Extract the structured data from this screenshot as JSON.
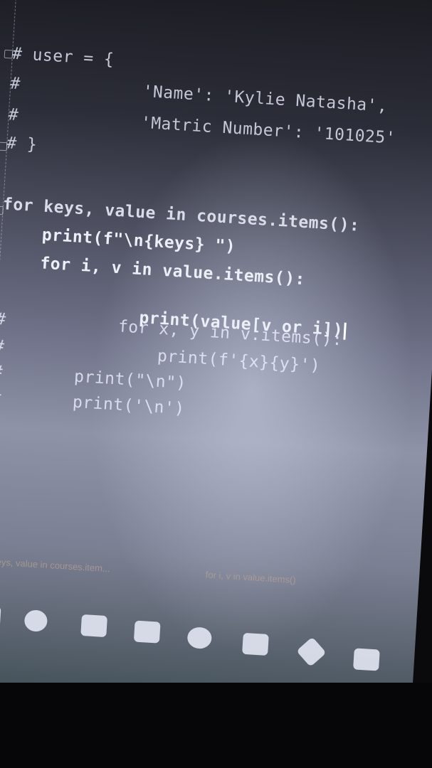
{
  "editor": {
    "top_fragment": "}",
    "lines": [
      {
        "id": "l1",
        "text": "# user = {"
      },
      {
        "id": "l2",
        "text": "#            'Name': 'Kylie Natasha',"
      },
      {
        "id": "l3",
        "text": "#            'Matric Number': '101025'"
      },
      {
        "id": "l4",
        "text": "# }"
      },
      {
        "id": "l5",
        "text": "for keys, value in courses.items():"
      },
      {
        "id": "l6",
        "text": "    print(f\"\\n{keys} \")"
      },
      {
        "id": "l7",
        "text": "    for i, v in value.items():"
      },
      {
        "id": "l8",
        "text": "        print(value[v or i])"
      },
      {
        "id": "l9",
        "text": "#           for x, y in v.items():"
      },
      {
        "id": "l10",
        "text": "#               print(f'{x}{y}')"
      },
      {
        "id": "l11",
        "text": "#       print(\"\\n\")"
      },
      {
        "id": "l12",
        "text": "#       print('\\n')"
      }
    ]
  },
  "breadcrumbs": {
    "left": "for keys, value in courses.item...",
    "right": "for i, v in value.items()"
  },
  "taskbar": {
    "icons": [
      "app-icon",
      "browser-icon",
      "store-icon",
      "mail-icon",
      "chat-icon",
      "folder-icon",
      "sublime-icon",
      "terminal-icon"
    ]
  }
}
